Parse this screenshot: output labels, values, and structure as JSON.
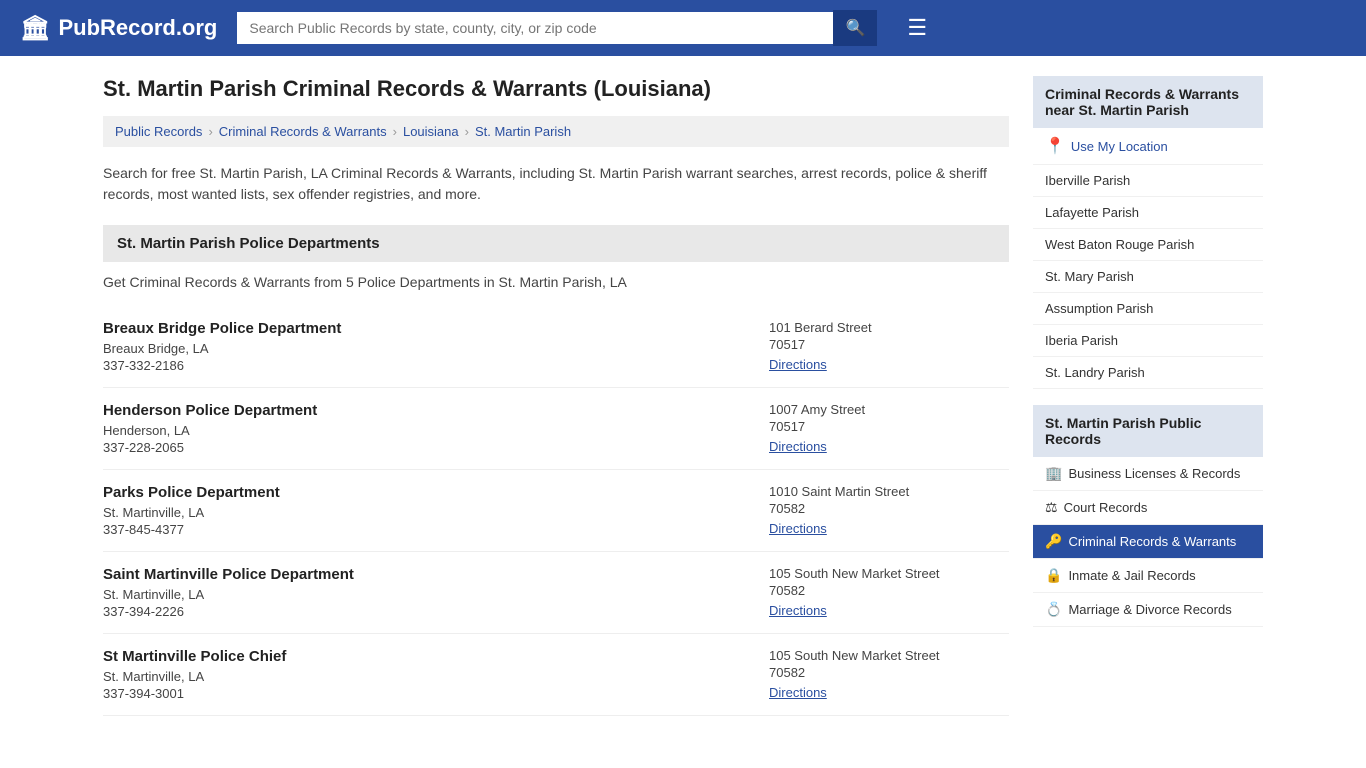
{
  "header": {
    "logo_text": "PubRecord.org",
    "search_placeholder": "Search Public Records by state, county, city, or zip code"
  },
  "page": {
    "title": "St. Martin Parish Criminal Records & Warrants (Louisiana)",
    "description": "Search for free St. Martin Parish, LA Criminal Records & Warrants, including St. Martin Parish warrant searches, arrest records, police & sheriff records, most wanted lists, sex offender registries, and more.",
    "section_header": "St. Martin Parish Police Departments",
    "section_sub": "Get Criminal Records & Warrants from 5 Police Departments in St. Martin Parish, LA"
  },
  "breadcrumb": {
    "items": [
      {
        "label": "Public Records",
        "href": "#"
      },
      {
        "label": "Criminal Records & Warrants",
        "href": "#"
      },
      {
        "label": "Louisiana",
        "href": "#"
      },
      {
        "label": "St. Martin Parish",
        "href": "#"
      }
    ]
  },
  "departments": [
    {
      "name": "Breaux Bridge Police Department",
      "city": "Breaux Bridge, LA",
      "phone": "337-332-2186",
      "address": "101 Berard Street",
      "zip": "70517",
      "directions_label": "Directions"
    },
    {
      "name": "Henderson Police Department",
      "city": "Henderson, LA",
      "phone": "337-228-2065",
      "address": "1007 Amy Street",
      "zip": "70517",
      "directions_label": "Directions"
    },
    {
      "name": "Parks Police Department",
      "city": "St. Martinville, LA",
      "phone": "337-845-4377",
      "address": "1010 Saint Martin Street",
      "zip": "70582",
      "directions_label": "Directions"
    },
    {
      "name": "Saint Martinville Police Department",
      "city": "St. Martinville, LA",
      "phone": "337-394-2226",
      "address": "105 South New Market Street",
      "zip": "70582",
      "directions_label": "Directions"
    },
    {
      "name": "St Martinville Police Chief",
      "city": "St. Martinville, LA",
      "phone": "337-394-3001",
      "address": "105 South New Market Street",
      "zip": "70582",
      "directions_label": "Directions"
    }
  ],
  "sidebar": {
    "nearby_title": "Criminal Records & Warrants near St. Martin Parish",
    "use_location": "Use My Location",
    "nearby_items": [
      "Iberville Parish",
      "Lafayette Parish",
      "West Baton Rouge Parish",
      "St. Mary Parish",
      "Assumption Parish",
      "Iberia Parish",
      "St. Landry Parish"
    ],
    "records_title": "St. Martin Parish Public Records",
    "records_items": [
      {
        "label": "Business Licenses & Records",
        "icon": "🏢",
        "active": false
      },
      {
        "label": "Court Records",
        "icon": "⚖",
        "active": false
      },
      {
        "label": "Criminal Records & Warrants",
        "icon": "🔑",
        "active": true
      },
      {
        "label": "Inmate & Jail Records",
        "icon": "🔒",
        "active": false
      },
      {
        "label": "Marriage & Divorce Records",
        "icon": "💍",
        "active": false
      }
    ]
  }
}
